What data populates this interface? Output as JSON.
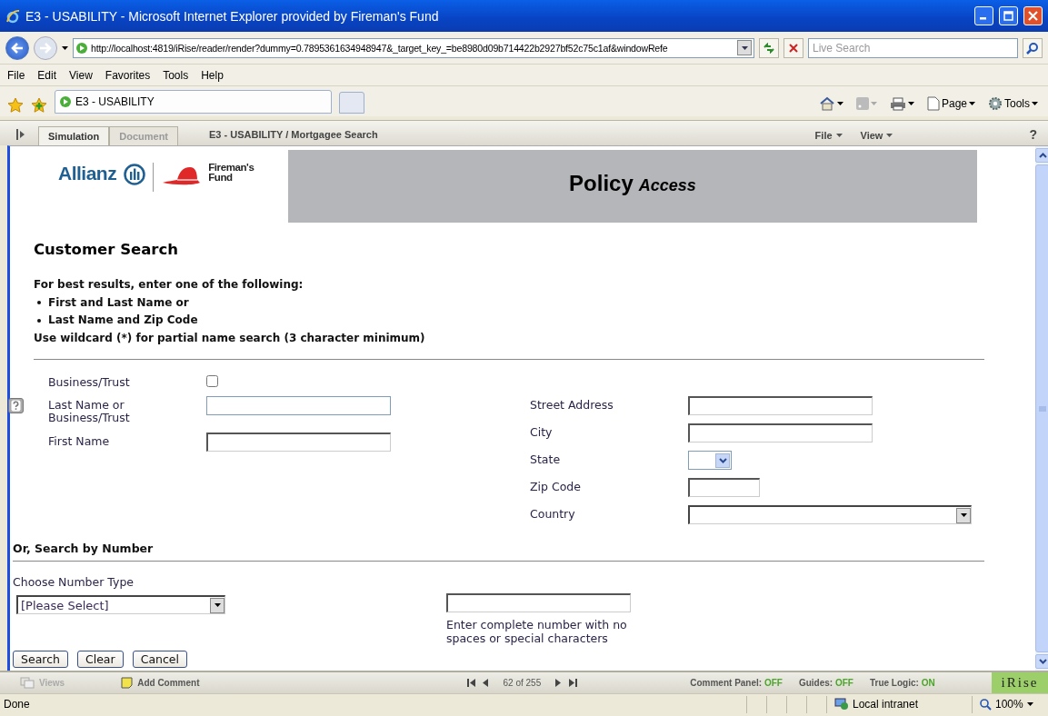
{
  "window": {
    "title": "E3 - USABILITY - Microsoft Internet Explorer provided by Fireman's Fund"
  },
  "address_bar": {
    "url": "http://localhost:4819/iRise/reader/render?dummy=0.7895361634948947&_target_key_=be8980d09b714422b2927bf52c75c1af&windowRefe",
    "search_placeholder": "Live Search"
  },
  "menu": [
    "File",
    "Edit",
    "View",
    "Favorites",
    "Tools",
    "Help"
  ],
  "browser_tab": {
    "title": "E3 - USABILITY"
  },
  "command_bar": [
    "Page",
    "Tools"
  ],
  "irise_toolbar": {
    "tabs": [
      {
        "label": "Simulation",
        "selected": true
      },
      {
        "label": "Document",
        "selected": false
      }
    ],
    "breadcrumb": "E3 - USABILITY / Mortgagee Search",
    "menus": [
      "File",
      "View"
    ],
    "help": "?"
  },
  "page": {
    "logo": {
      "brand": "Allianz",
      "partner_line_1": "Fireman's",
      "partner_line_2": "Fund"
    },
    "banner": {
      "title": "Policy",
      "subtitle": "Access"
    },
    "heading": "Customer Search",
    "intro": "For best results, enter one of the following:",
    "bullets": [
      "First and Last Name or",
      "Last Name and Zip Code"
    ],
    "note": "Use wildcard (*) for partial name search (3 character minimum)",
    "left_fields": [
      {
        "kind": "checkbox",
        "label": "Business/Trust",
        "checked": false,
        "help": false
      },
      {
        "kind": "text",
        "label": "Last Name or Business/Trust",
        "help": true,
        "focused": true
      },
      {
        "kind": "text",
        "label": "First Name",
        "help": false,
        "focused": false
      }
    ],
    "right_fields": [
      {
        "kind": "text",
        "label": "Street Address"
      },
      {
        "kind": "text",
        "label": "City"
      },
      {
        "kind": "state",
        "label": "State"
      },
      {
        "kind": "zip",
        "label": "Zip Code"
      },
      {
        "kind": "select",
        "label": "Country"
      }
    ],
    "number_section": {
      "heading": "Or, Search by Number",
      "type_label": "Choose Number Type",
      "type_value": "[Please Select]",
      "hint": "Enter complete number with no spaces or special characters"
    },
    "buttons": [
      "Search",
      "Clear",
      "Cancel"
    ]
  },
  "irise_bottom": {
    "views": {
      "label": "Views",
      "disabled": true
    },
    "add_comment": "Add Comment",
    "pager": "62 of 255",
    "toggles": [
      {
        "label": "Comment Panel:",
        "value": "OFF"
      },
      {
        "label": "Guides:",
        "value": "OFF"
      },
      {
        "label": "True Logic:",
        "value": "ON"
      }
    ],
    "brand": "iRise"
  },
  "status_bar": {
    "text": "Done",
    "zone": "Local intranet",
    "zoom": "100%"
  }
}
